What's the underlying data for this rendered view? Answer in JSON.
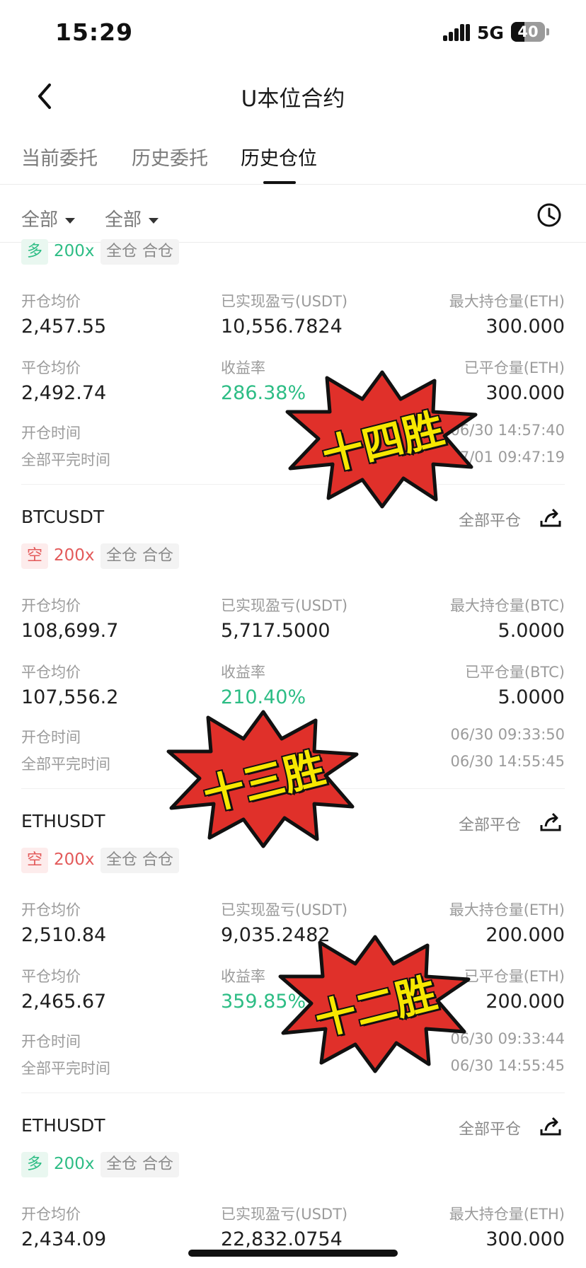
{
  "status": {
    "time": "15:29",
    "network": "5G",
    "battery": "40",
    "battery_level": 0.4
  },
  "header": {
    "title": "U本位合约"
  },
  "tabs": [
    {
      "label": "当前委托"
    },
    {
      "label": "历史委托"
    },
    {
      "label": "历史仓位"
    }
  ],
  "active_tab": 2,
  "filters": [
    {
      "label": "全部"
    },
    {
      "label": "全部"
    }
  ],
  "labels": {
    "open_avg": "开仓均价",
    "realized_pnl": "已实现盈亏(USDT)",
    "close_avg": "平仓均价",
    "roi": "收益率",
    "open_time": "开仓时间",
    "full_close_time": "全部平完时间",
    "close_all": "全部平仓",
    "cross": "全仓",
    "merge": "合仓"
  },
  "positions": [
    {
      "symbol": "",
      "side": "多",
      "leverage": "200x",
      "open_avg": "2,457.55",
      "realized_pnl": "10,556.7824",
      "max_label": "最大持仓量(ETH)",
      "max_qty": "300.000",
      "close_avg": "2,492.74",
      "roi": "286.38%",
      "closed_label": "已平仓量(ETH)",
      "closed_qty": "300.000",
      "open_time": "06/30 14:57:40",
      "close_time": "07/01 09:47:19"
    },
    {
      "symbol": "BTCUSDT",
      "side": "空",
      "leverage": "200x",
      "open_avg": "108,699.7",
      "realized_pnl": "5,717.5000",
      "max_label": "最大持仓量(BTC)",
      "max_qty": "5.0000",
      "close_avg": "107,556.2",
      "roi": "210.40%",
      "closed_label": "已平仓量(BTC)",
      "closed_qty": "5.0000",
      "open_time": "06/30 09:33:50",
      "close_time": "06/30 14:55:45"
    },
    {
      "symbol": "ETHUSDT",
      "side": "空",
      "leverage": "200x",
      "open_avg": "2,510.84",
      "realized_pnl": "9,035.2482",
      "max_label": "最大持仓量(ETH)",
      "max_qty": "200.000",
      "close_avg": "2,465.67",
      "roi": "359.85%",
      "closed_label": "已平仓量(ETH)",
      "closed_qty": "200.000",
      "open_time": "06/30 09:33:44",
      "close_time": "06/30 14:55:45"
    },
    {
      "symbol": "ETHUSDT",
      "side": "多",
      "leverage": "200x",
      "open_avg": "2,434.09",
      "realized_pnl": "22,832.0754",
      "max_label": "最大持仓量(ETH)",
      "max_qty": "300.000"
    }
  ],
  "stickers": [
    {
      "text": "十四胜"
    },
    {
      "text": "十三胜"
    },
    {
      "text": "十二胜"
    }
  ],
  "colors": {
    "green": "#2dbd85",
    "red": "#e35a5a",
    "sticker_red": "#e0302a",
    "sticker_text": "#f7e800"
  }
}
